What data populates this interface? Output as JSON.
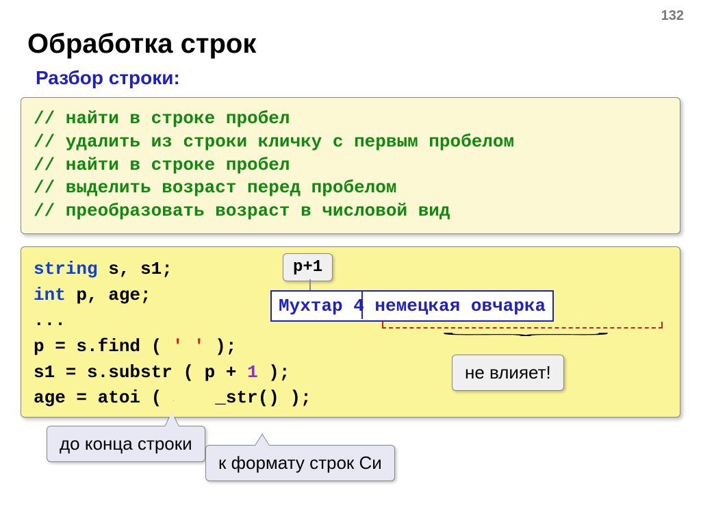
{
  "page_number": "132",
  "title": "Обработка строк",
  "subtitle": "Разбор строки:",
  "comments": [
    "// найти в строке пробел",
    "// удалить из строки кличку с первым пробелом",
    "// найти в строке пробел",
    "// выделить возраст перед пробелом",
    "// преобразовать возраст в числовой вид"
  ],
  "code": {
    "kw_string": "string",
    "decl1_rest": " s, s1;",
    "kw_int": "int",
    "decl2_rest": " p, age;",
    "dots": "...",
    "line4_a": "p = s.find ( ",
    "line4_lit": "' '",
    "line4_b": " );",
    "line5_a": "s1 = s.substr ( p + ",
    "line5_one": "1",
    "line5_b": " );",
    "line6": "age = atoi ( s1.c_str() );"
  },
  "tag_p1": "p+1",
  "sample": {
    "part1": "Мухтар ",
    "part2": "4 немецкая овчарка"
  },
  "note_right": "не влияет!",
  "callout_left": "до конца строки",
  "callout_right": "к формату строк Си"
}
